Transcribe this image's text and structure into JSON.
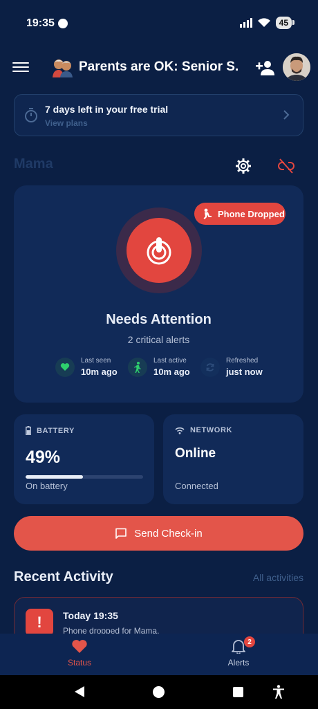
{
  "status_bar": {
    "time": "19:35",
    "battery_level": "45"
  },
  "app_bar": {
    "title": "Parents are OK: Senior S..."
  },
  "trial": {
    "title": "7 days left in your free trial",
    "link": "View plans"
  },
  "profile": {
    "name": "Mama"
  },
  "status_card": {
    "badge": "Phone Dropped",
    "title": "Needs Attention",
    "subtitle": "2 critical alerts",
    "metrics": [
      {
        "label": "Last seen",
        "value": "10m ago",
        "icon": "heart-icon"
      },
      {
        "label": "Last active",
        "value": "10m ago",
        "icon": "walking-icon"
      },
      {
        "label": "Refreshed",
        "value": "just now",
        "icon": "refresh-icon"
      }
    ]
  },
  "battery": {
    "label": "BATTERY",
    "value": "49%",
    "level": 0.49,
    "status": "On battery"
  },
  "network": {
    "label": "NETWORK",
    "value": "Online",
    "status": "Connected"
  },
  "checkin": {
    "label": "Send Check-in"
  },
  "recent": {
    "title": "Recent Activity",
    "link": "All activities",
    "items": [
      {
        "time": "Today 19:35",
        "description": "Phone dropped for Mama."
      }
    ]
  },
  "bottom_nav": {
    "status": "Status",
    "alerts": "Alerts",
    "alerts_count": "2"
  },
  "colors": {
    "accent": "#e2463f",
    "background": "#0b1f44",
    "card": "#112a58"
  }
}
